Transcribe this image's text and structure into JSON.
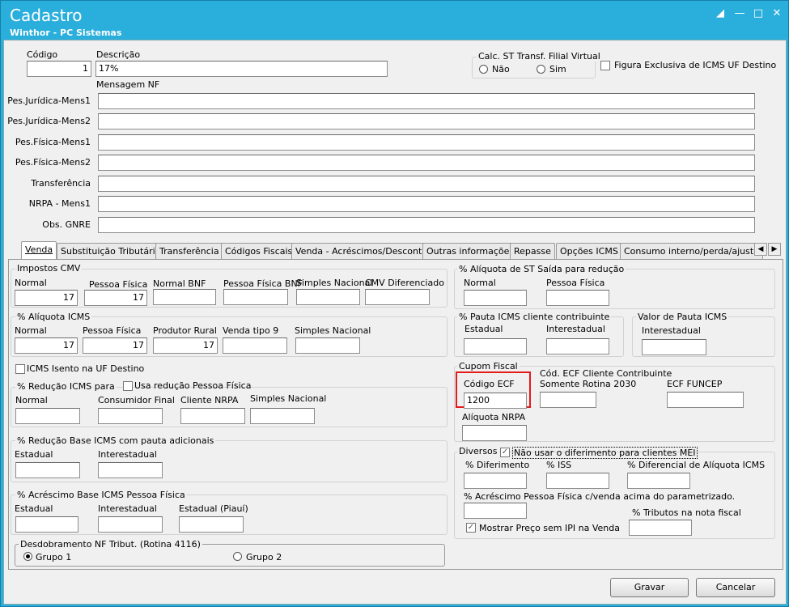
{
  "window": {
    "title": "Cadastro",
    "subtitle": "Winthor - PC Sistemas"
  },
  "header": {
    "codigo_label": "Código",
    "codigo_value": "1",
    "descricao_label": "Descrição",
    "descricao_value": "17%",
    "calc_st_title": "Calc. ST Transf. Filial Virtual",
    "calc_st_nao": "Não",
    "calc_st_sim": "Sim",
    "figura_exclusiva": "Figura Exclusiva de ICMS UF Destino",
    "mensagem_nf": "Mensagem NF",
    "messages": [
      {
        "label": "Pes.Jurídica-Mens1",
        "value": ""
      },
      {
        "label": "Pes.Jurídica-Mens2",
        "value": ""
      },
      {
        "label": "Pes.Física-Mens1",
        "value": ""
      },
      {
        "label": "Pes.Física-Mens2",
        "value": ""
      },
      {
        "label": "Transferência",
        "value": ""
      },
      {
        "label": "NRPA - Mens1",
        "value": ""
      },
      {
        "label": "Obs. GNRE",
        "value": ""
      }
    ]
  },
  "tabs": [
    "Venda",
    "Substituição Tributária",
    "Transferência",
    "Códigos Fiscais",
    "Venda - Acréscimos/Descontos",
    "Outras informações",
    "Repasse",
    "Opções ICMS",
    "Consumo interno/perda/ajuste"
  ],
  "impostos_cmv": {
    "title": "Impostos CMV",
    "fields": [
      {
        "label": "Normal",
        "value": "17"
      },
      {
        "label": "Pessoa Física",
        "value": "17"
      },
      {
        "label": "Normal BNF",
        "value": ""
      },
      {
        "label": "Pessoa Física BNF",
        "value": ""
      },
      {
        "label": "Simples Nacional",
        "value": ""
      },
      {
        "label": "CMV Diferenciado",
        "value": ""
      }
    ]
  },
  "aliquota_icms": {
    "title": "% Alíquota ICMS",
    "fields": [
      {
        "label": "Normal",
        "value": "17"
      },
      {
        "label": "Pessoa Física",
        "value": "17"
      },
      {
        "label": "Produtor Rural",
        "value": "17"
      },
      {
        "label": "Venda tipo 9",
        "value": ""
      },
      {
        "label": "Simples Nacional",
        "value": ""
      }
    ]
  },
  "icms_isento": "ICMS Isento na UF Destino",
  "reducao_icms": {
    "title": "% Redução ICMS para",
    "usa_reducao": "Usa redução Pessoa Física",
    "fields": [
      {
        "label": "Normal",
        "value": ""
      },
      {
        "label": "Consumidor Final",
        "value": ""
      },
      {
        "label": "Cliente NRPA",
        "value": ""
      },
      {
        "label": "Simples Nacional",
        "value": ""
      }
    ]
  },
  "reducao_base": {
    "title": "% Redução Base ICMS com pauta adicionais",
    "fields": [
      {
        "label": "Estadual",
        "value": ""
      },
      {
        "label": "Interestadual",
        "value": ""
      }
    ]
  },
  "acrescimo_base": {
    "title": "% Acréscimo Base ICMS Pessoa Física",
    "fields": [
      {
        "label": "Estadual",
        "value": ""
      },
      {
        "label": "Interestadual",
        "value": ""
      },
      {
        "label": "Estadual (Piauí)",
        "value": ""
      }
    ]
  },
  "desdobramento": {
    "title": "Desdobramento NF Tribut. (Rotina 4116)",
    "grupo1": "Grupo 1",
    "grupo2": "Grupo 2"
  },
  "aliquota_st": {
    "title": "% Alíquota de ST Saída para redução",
    "fields": [
      {
        "label": "Normal",
        "value": ""
      },
      {
        "label": "Pessoa Física",
        "value": ""
      }
    ]
  },
  "pauta_icms": {
    "title": "% Pauta ICMS cliente contribuinte",
    "fields": [
      {
        "label": "Estadual",
        "value": ""
      },
      {
        "label": "Interestadual",
        "value": ""
      }
    ]
  },
  "valor_pauta": {
    "title": "Valor de Pauta ICMS",
    "interestadual_label": "Interestadual",
    "interestadual_value": ""
  },
  "cupom_fiscal": {
    "title": "Cupom Fiscal",
    "codigo_ecf_label": "Código ECF",
    "codigo_ecf_value": "1200",
    "cod_ecf_cliente_label1": "Cód. ECF Cliente Contribuinte",
    "cod_ecf_cliente_label2": "Somente Rotina 2030",
    "cod_ecf_cliente_value": "",
    "ecf_funcep_label": "ECF FUNCEP",
    "ecf_funcep_value": "",
    "aliquota_nrpa_label": "Alíquota NRPA",
    "aliquota_nrpa_value": ""
  },
  "diversos": {
    "title": "Diversos",
    "nao_usar": "Não usar o diferimento para clientes MEI",
    "diferimento_label": "% Diferimento",
    "iss_label": "% ISS",
    "diferencial_label": "% Diferencial de Alíquota ICMS",
    "acrescimo_pf_label": "% Acréscimo Pessoa Física c/venda acima do parametrizado.",
    "tributos_label": "% Tributos na nota fiscal",
    "mostrar_preco": "Mostrar Preço sem IPI na Venda"
  },
  "footer": {
    "gravar": "Gravar",
    "cancelar": "Cancelar"
  },
  "colors": {
    "titlebar": "#2aaedb",
    "highlight": "#e31b1b"
  }
}
